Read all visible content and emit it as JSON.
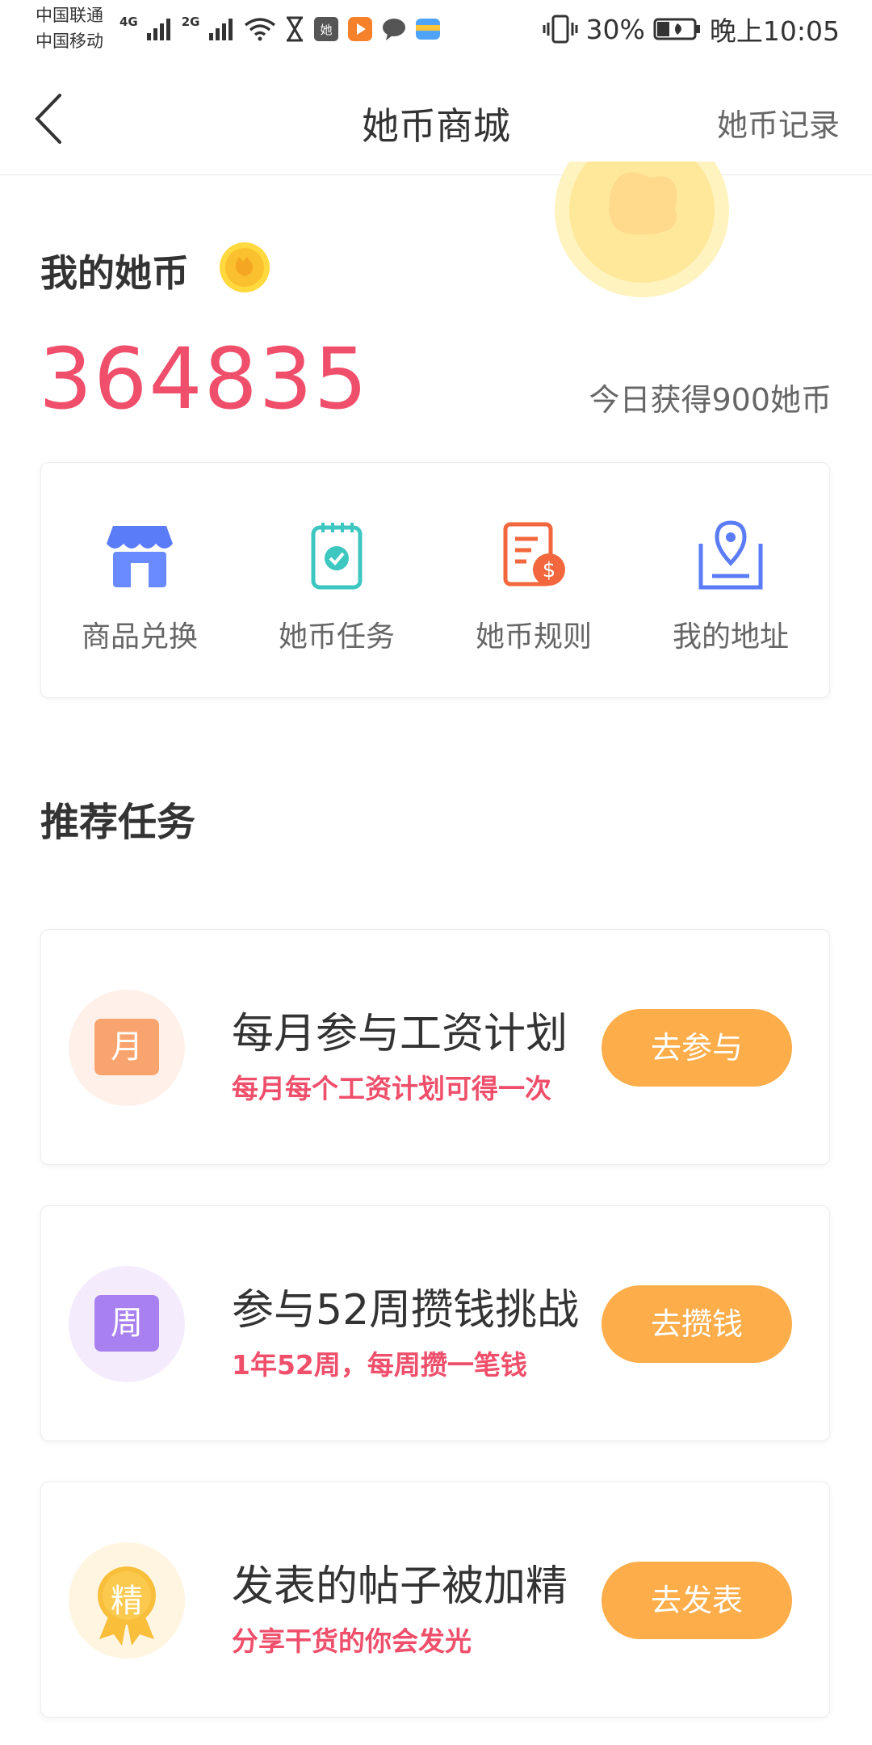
{
  "status_bar": {
    "carrier_1": "中国联通",
    "carrier_2": "中国移动",
    "net_1": "4G",
    "net_2": "2G",
    "battery": "30%",
    "time": "晚上10:05",
    "icons": [
      "signal-icon",
      "wifi-icon",
      "hourglass-icon",
      "app-ta-icon",
      "video-app-icon",
      "chat-icon",
      "wallet-icon",
      "vibrate-icon",
      "battery-icon"
    ]
  },
  "nav": {
    "title": "她币商城",
    "record": "她币记录",
    "back_icon": "chevron-left-icon"
  },
  "header": {
    "coin_label": "我的她币",
    "coin_value": "364835",
    "today_earn": "今日获得900她币"
  },
  "menu": [
    {
      "label": "商品兑换",
      "icon": "shop-icon",
      "color": "#5b7cf7"
    },
    {
      "label": "她币任务",
      "icon": "task-clipboard-icon",
      "color": "#3ec6c0"
    },
    {
      "label": "她币规则",
      "icon": "rules-coin-icon",
      "color": "#f2673d"
    },
    {
      "label": "我的地址",
      "icon": "location-icon",
      "color": "#5b7cf7"
    }
  ],
  "section_title": "推荐任务",
  "tasks": [
    {
      "badge": "月",
      "title": "每月参与工资计划",
      "subtitle": "每月每个工资计划可得一次",
      "button": "去参与",
      "badge_color": "#f9a46e",
      "badge_bg": "#fff1ea"
    },
    {
      "badge": "周",
      "title": "参与52周攒钱挑战",
      "subtitle": "1年52周，每周攒一笔钱",
      "button": "去攒钱",
      "badge_color": "#a880f0",
      "badge_bg": "#f4ecfd"
    },
    {
      "badge": "精",
      "title": "发表的帖子被加精",
      "subtitle": "分享干货的你会发光",
      "button": "去发表",
      "badge_color": "#f9be3a",
      "badge_bg": "#fff5e0"
    }
  ],
  "colors": {
    "accent_red": "#ef4f6b",
    "button_orange": "#fdad4a"
  }
}
